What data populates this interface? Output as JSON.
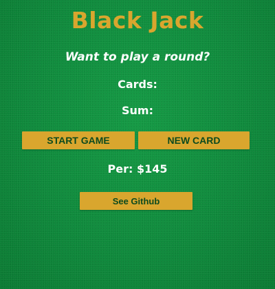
{
  "title": "Black Jack",
  "message": "Want to play a round?",
  "cards_label": "Cards:",
  "sum_label": "Sum:",
  "buttons": {
    "start": "START GAME",
    "new_card": "NEW CARD",
    "github": "See Github"
  },
  "player": "Per: $145",
  "colors": {
    "table_green": "#0f8a3c",
    "gold": "#d9a62e",
    "button_text": "#0c4a1e"
  }
}
